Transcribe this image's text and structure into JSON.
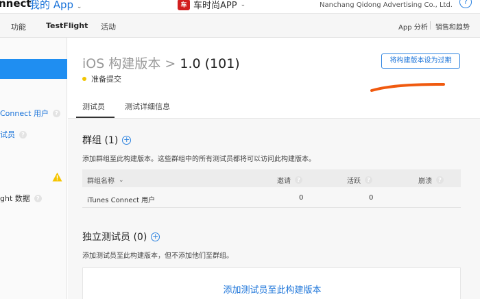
{
  "header": {
    "brand": "nnect",
    "my_app": "我的 App",
    "app_logo": "车",
    "app_name": "车时尚APP",
    "company": "Nanchang Qidong Advertising Co., Ltd.",
    "help": "?"
  },
  "tabs": [
    {
      "label": "功能",
      "active": false
    },
    {
      "label": "TestFlight",
      "active": true
    },
    {
      "label": "活动",
      "active": false
    }
  ],
  "tabs_right": [
    "App 分析",
    "销售和趋势"
  ],
  "sidebar": {
    "items": [
      {
        "label": "Connect 用户"
      },
      {
        "label": "试员"
      },
      {
        "label": "ght 数据"
      }
    ]
  },
  "build": {
    "title": "iOS 构建版本",
    "separator": ">",
    "version": "1.0 (101)",
    "status": "准备提交",
    "status_color": "#f2c500",
    "expire_button": "将构建版本设为过期"
  },
  "subtabs": [
    "测试员",
    "测试详细信息"
  ],
  "groups": {
    "title": "群组 (1)",
    "description": "添加群组至此构建版本。这些群组中的所有测试员都将可以访问此构建版本。",
    "columns": [
      "群组名称",
      "邀请",
      "活跃",
      "崩溃"
    ],
    "rows": [
      {
        "name": "iTunes Connect 用户",
        "invites": "0",
        "active": "0",
        "crashes": ""
      }
    ]
  },
  "individual": {
    "title": "独立测试员 (0)",
    "description": "添加测试员至此构建版本，但不添加他们至群组。",
    "add_link": "添加测试员至此构建版本"
  },
  "colors": {
    "accent": "#1a73d9",
    "sidebar_active": "#1f8ef1",
    "annotation": "#f05a0f"
  }
}
